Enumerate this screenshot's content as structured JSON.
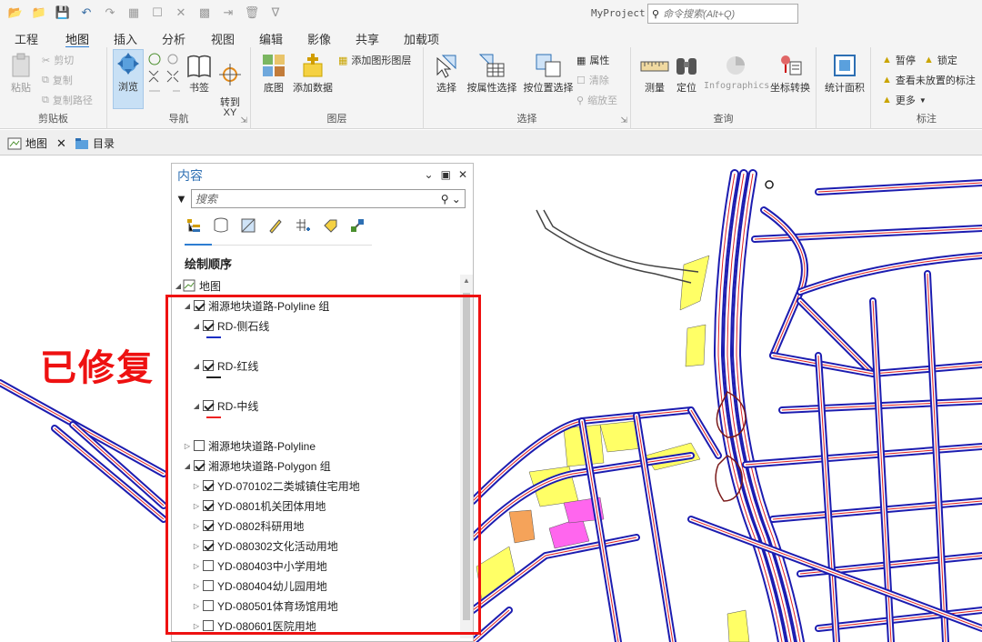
{
  "app": {
    "title": "MyProject",
    "command_search_placeholder": "命令搜索(Alt+Q)"
  },
  "ribbon_tabs": [
    "工程",
    "地图",
    "插入",
    "分析",
    "视图",
    "编辑",
    "影像",
    "共享",
    "加载项"
  ],
  "active_tab": "地图",
  "ribbon": {
    "clipboard": {
      "paste": "粘贴",
      "cut": "剪切",
      "copy": "复制",
      "copy_path": "复制路径",
      "label": "剪贴板"
    },
    "navigate": {
      "explore": "浏览",
      "bookmarks": "书签",
      "goto_xy": "转到\nXY",
      "label": "导航"
    },
    "layer": {
      "basemap": "底图",
      "add_data": "添加数据",
      "add_graphics_layer": "添加图形图层",
      "label": "图层"
    },
    "selection": {
      "select": "选择",
      "select_by_attr": "按属性选择",
      "select_by_location": "按位置选择",
      "attributes": "属性",
      "clear": "清除",
      "zoom_to": "缩放至",
      "label": "选择"
    },
    "inquiry": {
      "measure": "测量",
      "locate": "定位",
      "infographics": "Infographics",
      "coordinate_conversion": "坐标转换",
      "label": "查询"
    },
    "stats": {
      "stat_area": "统计面积"
    },
    "labeling": {
      "pause": "暂停",
      "lock": "锁定",
      "view_unplaced": "查看未放置的标注",
      "more": "更多",
      "label": "标注"
    }
  },
  "doc_tabs": [
    {
      "label": "地图"
    },
    {
      "label": "目录"
    }
  ],
  "contents": {
    "title": "内容",
    "search_placeholder": "搜索",
    "drawing_order": "绘制顺序",
    "map_name": "地图",
    "layers": [
      {
        "label": "湘源地块道路-Polyline 组",
        "checked": true,
        "expanded": true,
        "level": 0
      },
      {
        "label": "RD-侧石线",
        "checked": true,
        "expanded": true,
        "level": 1,
        "swatch": "#1c2fc4"
      },
      {
        "label": "RD-红线",
        "checked": true,
        "expanded": true,
        "level": 1,
        "swatch": "#222222"
      },
      {
        "label": "RD-中线",
        "checked": true,
        "expanded": true,
        "level": 1,
        "swatch": "#ee2222"
      },
      {
        "label": "湘源地块道路-Polyline",
        "checked": false,
        "expanded": false,
        "level": 0
      },
      {
        "label": "湘源地块道路-Polygon 组",
        "checked": true,
        "expanded": true,
        "level": 0
      },
      {
        "label": "YD-070102二类城镇住宅用地",
        "checked": true,
        "expanded": false,
        "level": 1
      },
      {
        "label": "YD-0801机关团体用地",
        "checked": true,
        "expanded": false,
        "level": 1
      },
      {
        "label": "YD-0802科研用地",
        "checked": true,
        "expanded": false,
        "level": 1
      },
      {
        "label": "YD-080302文化活动用地",
        "checked": true,
        "expanded": false,
        "level": 1
      },
      {
        "label": "YD-080403中小学用地",
        "checked": false,
        "expanded": false,
        "level": 1
      },
      {
        "label": "YD-080404幼儿园用地",
        "checked": false,
        "expanded": false,
        "level": 1
      },
      {
        "label": "YD-080501体育场馆用地",
        "checked": false,
        "expanded": false,
        "level": 1
      },
      {
        "label": "YD-080601医院用地",
        "checked": false,
        "expanded": false,
        "level": 1
      }
    ]
  },
  "annotation": {
    "text": "已修复",
    "color": "#ee1111"
  },
  "colors": {
    "road_edge": "#1c1cb0",
    "road_center": "#e02020",
    "residential": "#ffff66",
    "admin": "#ff66ee",
    "research": "#f5a35a"
  }
}
